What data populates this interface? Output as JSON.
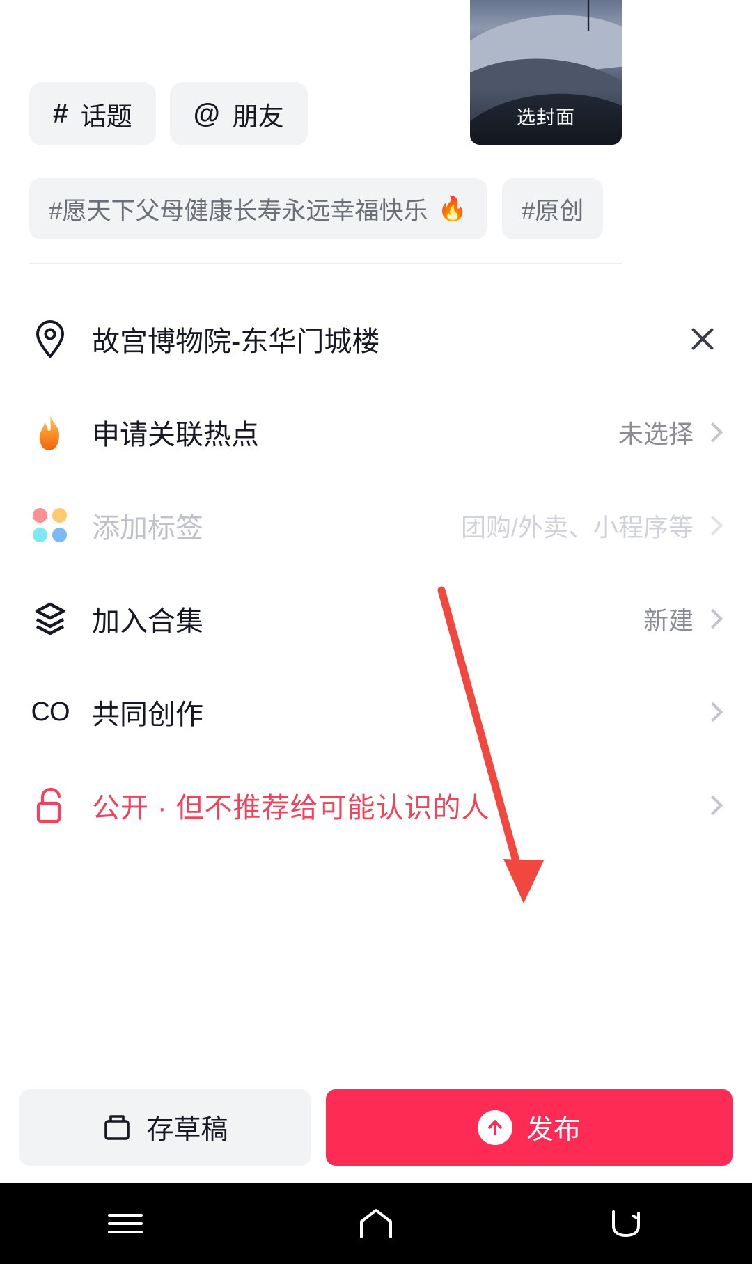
{
  "cover": {
    "label": "选封面",
    "image_alt": "horse-rider-snow-scene"
  },
  "quick_actions": [
    {
      "symbol": "#",
      "label": "话题",
      "name": "topic"
    },
    {
      "symbol": "@",
      "label": "朋友",
      "name": "friend"
    }
  ],
  "tag_suggestions": [
    {
      "text": "#愿天下父母健康长寿永远幸福快乐",
      "flame": "🔥"
    },
    {
      "text": "#原创",
      "flame": ""
    }
  ],
  "options": [
    {
      "icon": "location-pin-icon",
      "label": "故宫博物院-东华门城楼",
      "value": "",
      "trailing": "close",
      "style": "normal"
    },
    {
      "icon": "flame-icon",
      "label": "申请关联热点",
      "value": "未选择",
      "trailing": "chevron",
      "style": "normal"
    },
    {
      "icon": "four-dots-icon",
      "label": "添加标签",
      "value": "团购/外卖、小程序等",
      "trailing": "chevron",
      "style": "disabled"
    },
    {
      "icon": "layers-icon",
      "label": "加入合集",
      "value": "新建",
      "trailing": "chevron",
      "style": "normal"
    },
    {
      "icon": "co-create-icon",
      "label": "共同创作",
      "value": "",
      "trailing": "chevron",
      "style": "normal"
    },
    {
      "icon": "unlock-icon",
      "label": "公开 · 但不推荐给可能认识的人",
      "value": "",
      "trailing": "chevron",
      "style": "danger"
    }
  ],
  "bottom": {
    "draft_label": "存草稿",
    "publish_label": "发布"
  },
  "navbar": {
    "menu": "menu-icon",
    "home": "home-icon",
    "back": "back-icon"
  },
  "colors": {
    "accent": "#fe2c55",
    "danger_text": "#f0445c",
    "chip_bg": "#f2f3f5",
    "text_primary": "#161823",
    "text_secondary": "#8a8d95",
    "text_disabled": "#bfc2c9",
    "annotation_arrow": "#f0483f"
  }
}
